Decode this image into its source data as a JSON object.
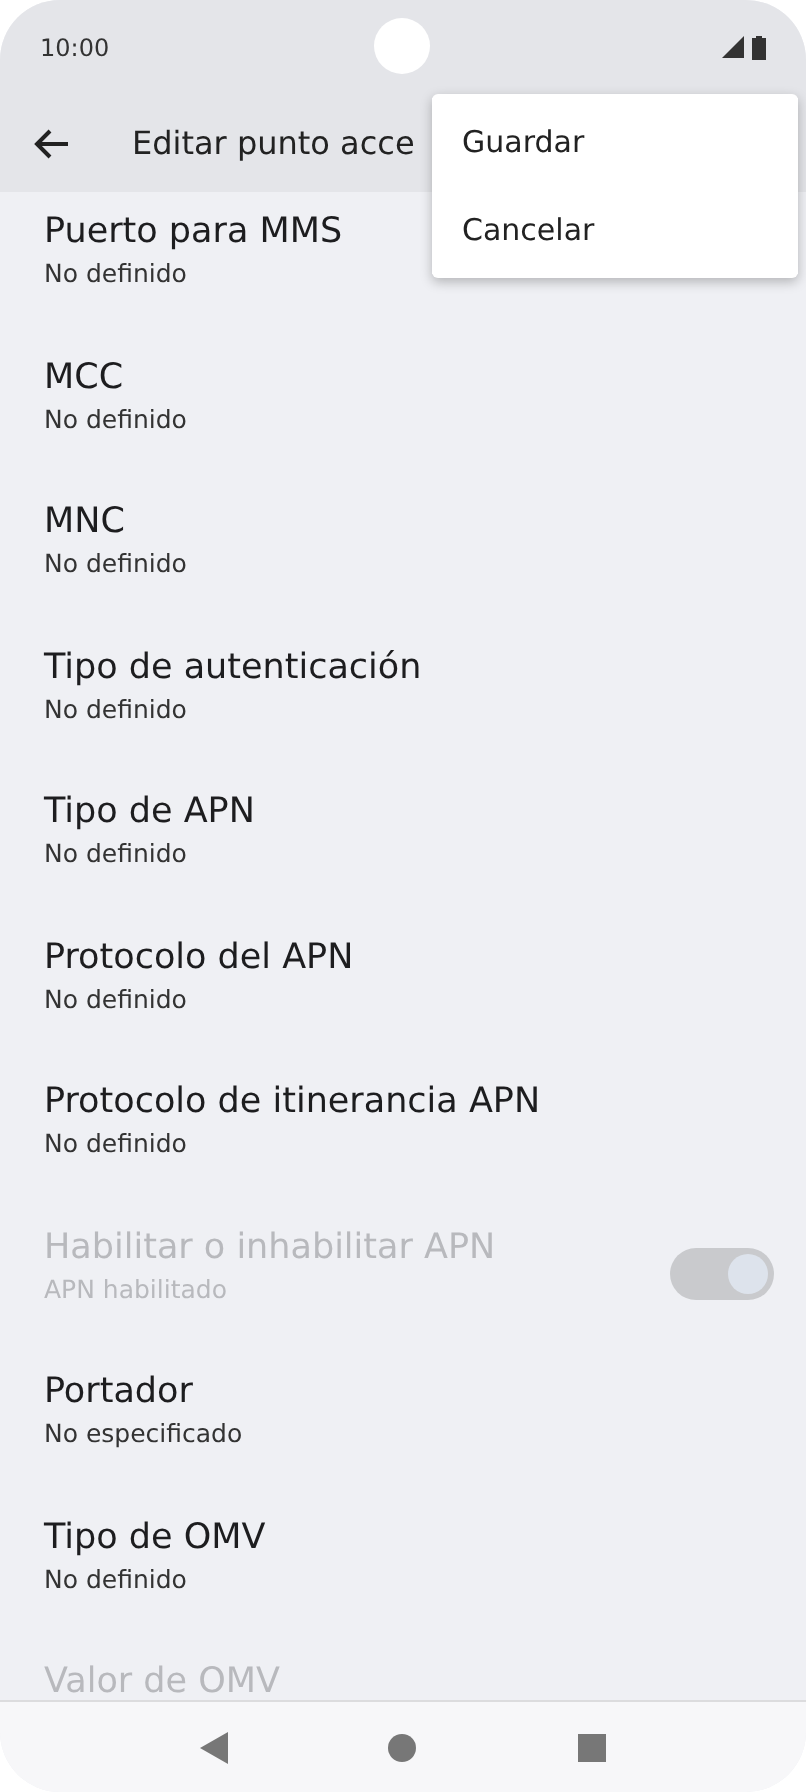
{
  "status_bar": {
    "time": "10:00"
  },
  "app_bar": {
    "title": "Editar punto acce"
  },
  "menu": {
    "items": [
      {
        "label": "Guardar"
      },
      {
        "label": "Cancelar"
      }
    ]
  },
  "settings": [
    {
      "kind": "text",
      "title": "Puerto para MMS",
      "summary": "No definido",
      "disabled": false
    },
    {
      "kind": "text",
      "title": "MCC",
      "summary": "No definido",
      "disabled": false
    },
    {
      "kind": "text",
      "title": "MNC",
      "summary": "No definido",
      "disabled": false
    },
    {
      "kind": "text",
      "title": "Tipo de autenticación",
      "summary": "No definido",
      "disabled": false
    },
    {
      "kind": "text",
      "title": "Tipo de APN",
      "summary": "No definido",
      "disabled": false
    },
    {
      "kind": "text",
      "title": "Protocolo del APN",
      "summary": "No definido",
      "disabled": false
    },
    {
      "kind": "text",
      "title": "Protocolo de itinerancia APN",
      "summary": "No definido",
      "disabled": false
    },
    {
      "kind": "switch",
      "title": "Habilitar o inhabilitar APN",
      "summary": "APN habilitado",
      "disabled": true,
      "on": true
    },
    {
      "kind": "text",
      "title": "Portador",
      "summary": "No especificado",
      "disabled": false
    },
    {
      "kind": "text",
      "title": "Tipo de OMV",
      "summary": "No definido",
      "disabled": false
    },
    {
      "kind": "text",
      "title": "Valor de OMV",
      "disabled": true
    }
  ]
}
